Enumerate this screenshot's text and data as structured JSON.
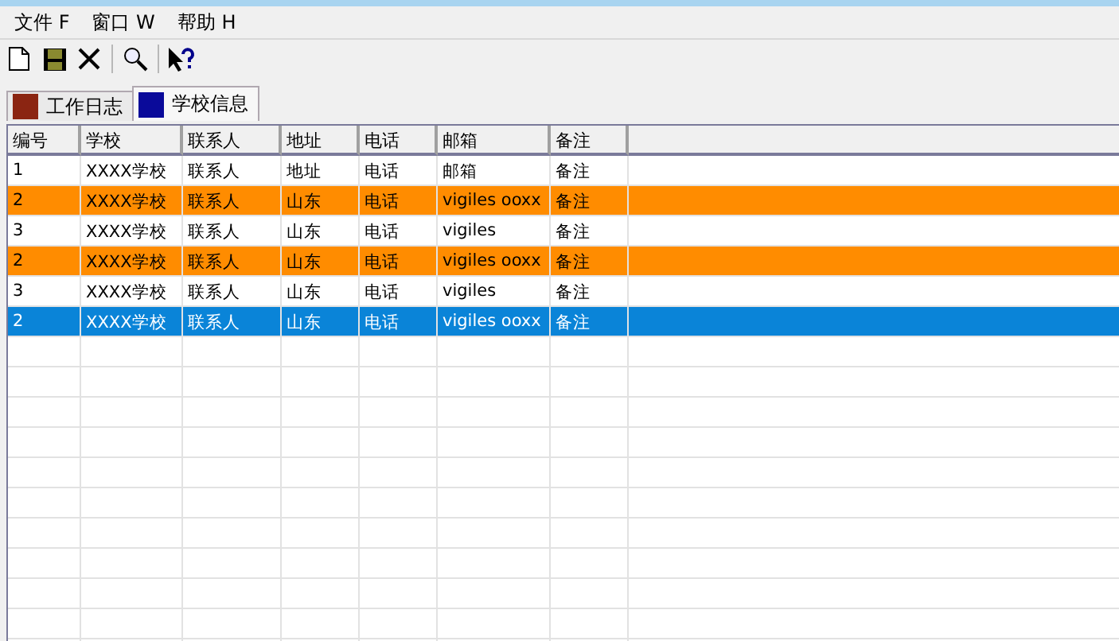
{
  "menu": [
    "文件 F",
    "窗口 W",
    "帮助 H"
  ],
  "tabs": [
    {
      "label": "工作日志",
      "color": "#8b2512",
      "selected": false
    },
    {
      "label": "学校信息",
      "color": "#0a0a9a",
      "selected": true
    }
  ],
  "table": {
    "columns": [
      "编号",
      "学校",
      "联系人",
      "地址",
      "电话",
      "邮箱",
      "备注"
    ],
    "rows": [
      {
        "cells": [
          "1",
          "XXXX学校",
          "联系人",
          "地址",
          "电话",
          "邮箱",
          "备注"
        ],
        "highlighted": false,
        "selected": false
      },
      {
        "cells": [
          "2",
          "XXXX学校",
          "联系人",
          "山东",
          "电话",
          "vigiles ooxx",
          "备注"
        ],
        "highlighted": true,
        "selected": false
      },
      {
        "cells": [
          "3",
          "XXXX学校",
          "联系人",
          "山东",
          "电话",
          "vigiles",
          "备注"
        ],
        "highlighted": false,
        "selected": false
      },
      {
        "cells": [
          "2",
          "XXXX学校",
          "联系人",
          "山东",
          "电话",
          "vigiles ooxx",
          "备注"
        ],
        "highlighted": true,
        "selected": false
      },
      {
        "cells": [
          "3",
          "XXXX学校",
          "联系人",
          "山东",
          "电话",
          "vigiles",
          "备注"
        ],
        "highlighted": false,
        "selected": false
      },
      {
        "cells": [
          "2",
          "XXXX学校",
          "联系人",
          "山东",
          "电话",
          "vigiles ooxx",
          "备注"
        ],
        "selected": true
      }
    ]
  }
}
